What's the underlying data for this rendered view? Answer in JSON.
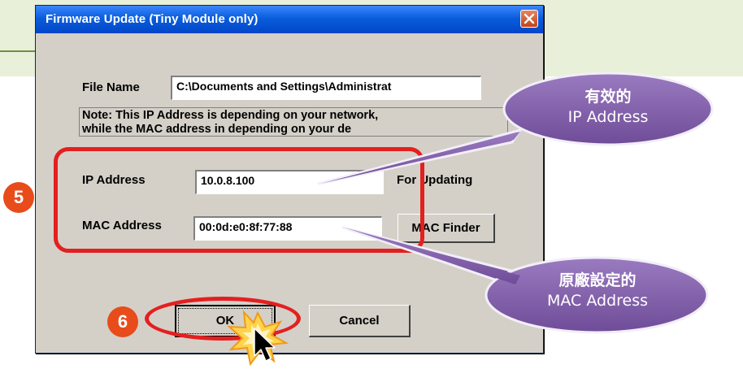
{
  "window": {
    "title": "Firmware Update (Tiny Module only)"
  },
  "file": {
    "label": "File Name",
    "value": "C:\\Documents and Settings\\Administrat"
  },
  "note": {
    "line1": "Note: This IP Address is depending on your network,",
    "line2": "while the  MAC address in depending on your de"
  },
  "ip": {
    "label": "IP Address",
    "value": "10.0.8.100",
    "suffix": "For Updating"
  },
  "mac": {
    "label": "MAC Address",
    "value": "00:0d:e0:8f:77:88",
    "button": "MAC Finder"
  },
  "buttons": {
    "ok": "OK",
    "cancel": "Cancel"
  },
  "steps": {
    "five": "5",
    "six": "6"
  },
  "callouts": {
    "ip": {
      "line1": "有效的",
      "line2": "IP Address"
    },
    "mac": {
      "line1": "原廠設定的",
      "line2": "MAC Address"
    }
  },
  "colors": {
    "highlight": "#e41f1f",
    "step_badge": "#e84c1a",
    "callout": "#7f5aa6",
    "titlebar": "#0a5ddc"
  },
  "icons": {
    "close": "close-icon",
    "cursor": "mouse-cursor-icon",
    "click_burst": "click-burst-icon"
  }
}
